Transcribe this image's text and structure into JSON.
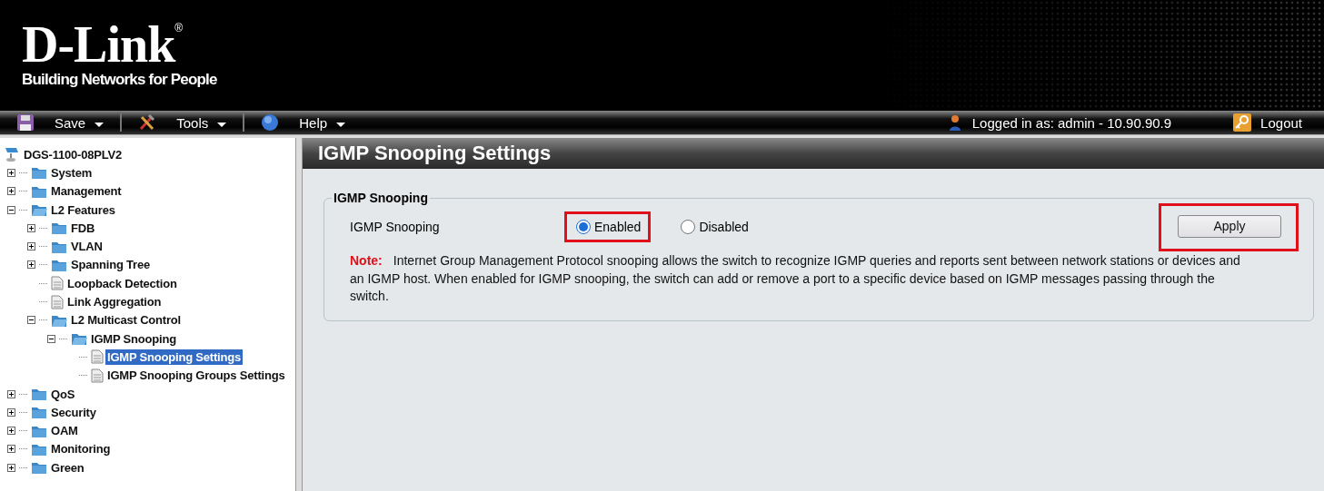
{
  "logo": {
    "name": "D-Link",
    "mark": "®",
    "tagline": "Building Networks for People"
  },
  "toolbar": {
    "menus": [
      {
        "label": "Save",
        "kind": "save"
      },
      {
        "label": "Tools",
        "kind": "tools"
      },
      {
        "label": "Help",
        "kind": "help"
      }
    ],
    "user": "Logged in as: admin - 10.90.90.9",
    "logout": "Logout"
  },
  "sidebar": {
    "root": "DGS-1100-08PLV2",
    "items": [
      {
        "label": "System",
        "kind": "folder",
        "expanded": false,
        "selected": false
      },
      {
        "label": "Management",
        "kind": "folder",
        "expanded": false,
        "selected": false
      },
      {
        "label": "L2 Features",
        "kind": "folder",
        "expanded": true,
        "selected": false,
        "children": [
          {
            "label": "FDB",
            "kind": "folder",
            "expanded": false,
            "selected": false
          },
          {
            "label": "VLAN",
            "kind": "folder",
            "expanded": false,
            "selected": false
          },
          {
            "label": "Spanning Tree",
            "kind": "folder",
            "expanded": false,
            "selected": false
          },
          {
            "label": "Loopback Detection",
            "kind": "page",
            "selected": false
          },
          {
            "label": "Link Aggregation",
            "kind": "page",
            "selected": false
          },
          {
            "label": "L2 Multicast Control",
            "kind": "folder",
            "expanded": true,
            "selected": false,
            "children": [
              {
                "label": "IGMP Snooping",
                "kind": "folder",
                "expanded": true,
                "selected": false,
                "children": [
                  {
                    "label": "IGMP Snooping Settings",
                    "kind": "page",
                    "selected": true
                  },
                  {
                    "label": "IGMP Snooping Groups Settings",
                    "kind": "page",
                    "selected": false
                  }
                ]
              }
            ]
          }
        ]
      },
      {
        "label": "QoS",
        "kind": "folder",
        "expanded": false,
        "selected": false
      },
      {
        "label": "Security",
        "kind": "folder",
        "expanded": false,
        "selected": false
      },
      {
        "label": "OAM",
        "kind": "folder",
        "expanded": false,
        "selected": false
      },
      {
        "label": "Monitoring",
        "kind": "folder",
        "expanded": false,
        "selected": false
      },
      {
        "label": "Green",
        "kind": "folder",
        "expanded": false,
        "selected": false
      }
    ]
  },
  "page": {
    "title": "IGMP Snooping Settings",
    "fieldset": {
      "legend": "IGMP Snooping",
      "field_label": "IGMP Snooping",
      "options": [
        {
          "label": "Enabled",
          "selected": true,
          "highlighted": true
        },
        {
          "label": "Disabled",
          "selected": false,
          "highlighted": false
        }
      ],
      "apply": {
        "label": "Apply",
        "highlighted": true
      },
      "note_label": "Note:",
      "note": "Internet Group Management Protocol snooping allows the switch to recognize IGMP queries and reports sent between network stations or devices and an IGMP host. When enabled for IGMP snooping, the switch can add or remove a port to a specific device based on IGMP messages passing through the switch."
    }
  }
}
